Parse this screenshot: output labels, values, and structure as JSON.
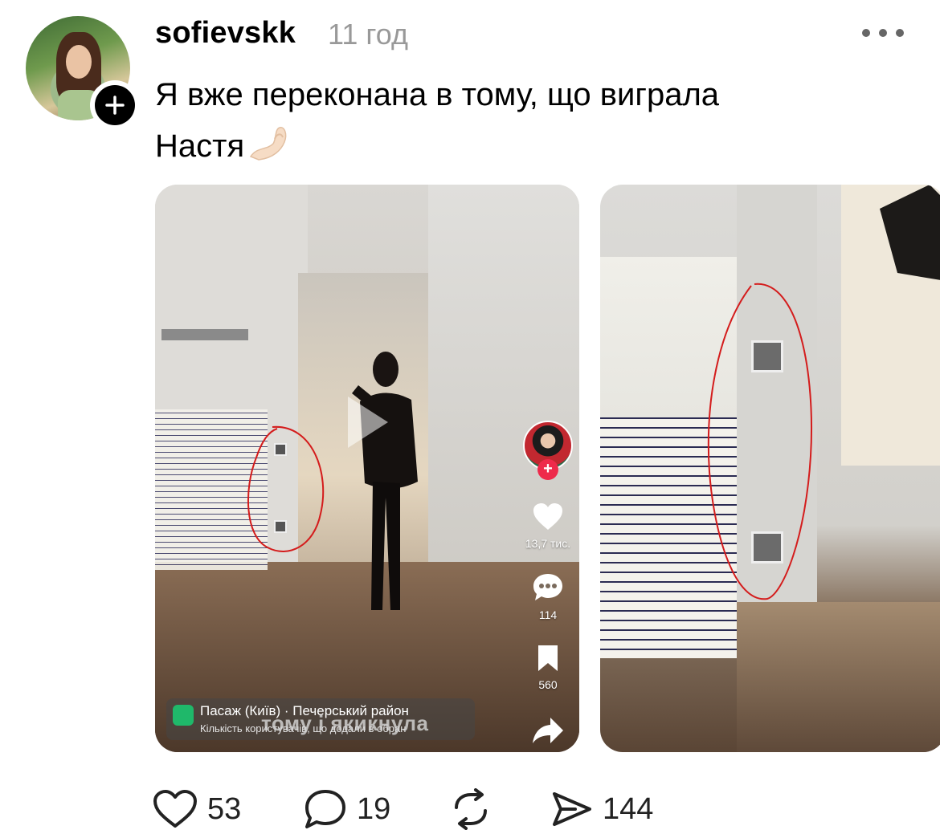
{
  "post": {
    "username": "sofievskk",
    "time": "11 год",
    "text_line1": "Я вже переконана в тому, що виграла",
    "text_line2": "Настя"
  },
  "media": {
    "video": {
      "likes": "13,7 тис.",
      "comments": "114",
      "saves": "560",
      "location_title": "Пасаж (Київ) · Печерський район",
      "location_sub": "Кількість користувачів, що додали в обран",
      "caption_overlay": "тому і якикнула"
    }
  },
  "actions": {
    "likes": "53",
    "comments": "19",
    "reposts": "",
    "shares": "144"
  },
  "colors": {
    "annotation_circle": "#d41c1c",
    "location_pin": "#1fb86a",
    "follow_plus": "#ee2a4b"
  }
}
